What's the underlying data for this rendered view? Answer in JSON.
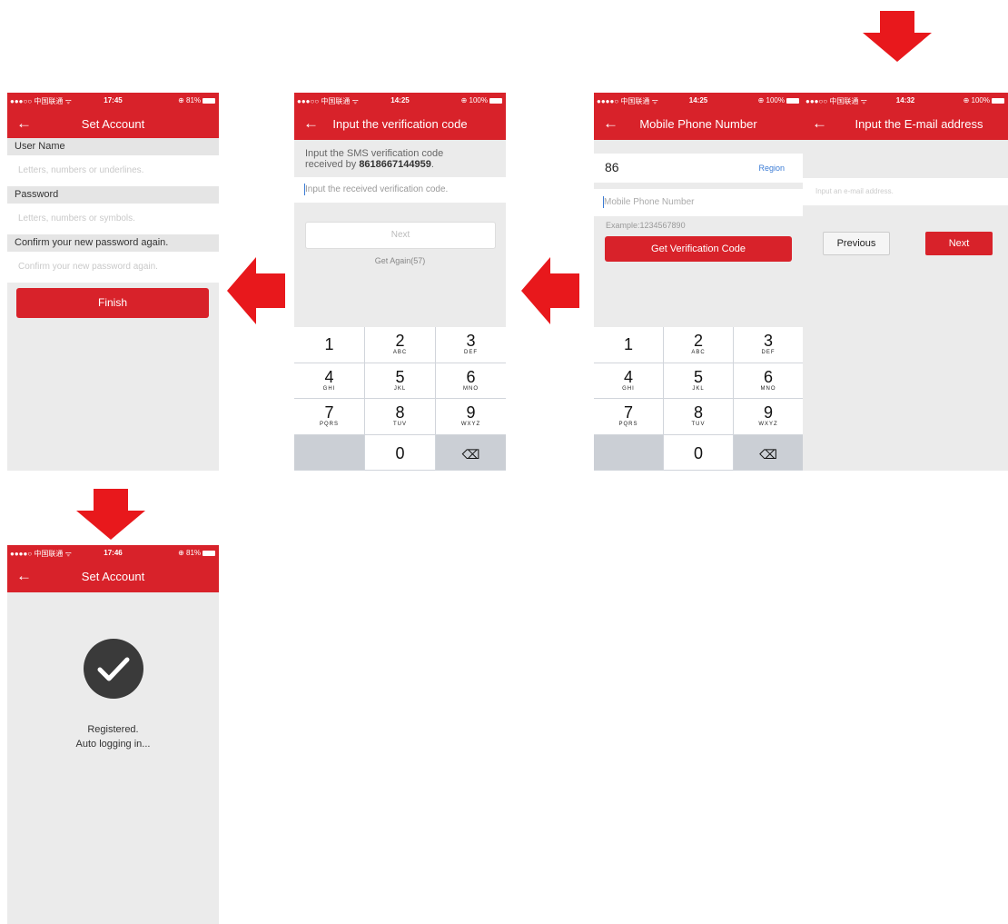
{
  "colors": {
    "brand_red": "#d8222a",
    "arrow_red": "#e8181c",
    "background": "#ebebeb",
    "link_blue": "#3a7bd5"
  },
  "screen_set_account": {
    "status": {
      "carrier": "●●●○○ 中国联通 ᯤ",
      "time": "17:45",
      "battery": "⊕ 81%"
    },
    "title": "Set Account",
    "username_label": "User Name",
    "username_placeholder": "Letters, numbers or underlines.",
    "password_label": "Password",
    "password_placeholder": "Letters, numbers or symbols.",
    "confirm_label": "Confirm your new password again.",
    "confirm_placeholder": "Confirm your new password again.",
    "finish_label": "Finish"
  },
  "screen_verification": {
    "status": {
      "carrier": "●●●○○ 中国联通 ᯤ",
      "time": "14:25",
      "battery": "⊕ 100%"
    },
    "title": "Input the verification code",
    "instruction_line1": "Input the SMS verification code",
    "instruction_prefix": "received by ",
    "phone_number": "8618667144959",
    "instruction_suffix": ".",
    "code_placeholder": "Input the received verification code.",
    "next_label": "Next",
    "get_again_label": "Get Again(57)"
  },
  "screen_mobile": {
    "status": {
      "carrier": "●●●●○ 中国联通 ᯤ",
      "time": "14:25",
      "battery": "⊕ 100%"
    },
    "title": "Mobile Phone Number",
    "country_code": "86",
    "region_label": "Region",
    "phone_placeholder": "Mobile Phone Number",
    "example_text": "Example:1234567890",
    "get_code_label": "Get Verification Code"
  },
  "screen_email": {
    "status": {
      "carrier": "●●●○○ 中国联通 ᯤ",
      "time": "14:32",
      "battery": "⊕ 100%"
    },
    "title": "Input the E-mail address",
    "email_placeholder": "Input an e-mail address.",
    "previous_label": "Previous",
    "next_label": "Next"
  },
  "screen_registered": {
    "status": {
      "carrier": "●●●●○ 中国联通 ᯤ",
      "time": "17:46",
      "battery": "⊕ 81%"
    },
    "title": "Set Account",
    "message_line1": "Registered.",
    "message_line2": "Auto logging in..."
  },
  "keypad": {
    "keys": [
      {
        "num": "1",
        "letters": ""
      },
      {
        "num": "2",
        "letters": "ABC"
      },
      {
        "num": "3",
        "letters": "DEF"
      },
      {
        "num": "4",
        "letters": "GHI"
      },
      {
        "num": "5",
        "letters": "JKL"
      },
      {
        "num": "6",
        "letters": "MNO"
      },
      {
        "num": "7",
        "letters": "PQRS"
      },
      {
        "num": "8",
        "letters": "TUV"
      },
      {
        "num": "9",
        "letters": "WXYZ"
      },
      {
        "num": "",
        "letters": ""
      },
      {
        "num": "0",
        "letters": ""
      },
      {
        "num": "⌫",
        "letters": ""
      }
    ]
  },
  "icons": {
    "back": "arrow-left-icon",
    "check": "checkmark-icon",
    "delete": "backspace-icon",
    "flow_arrow": "red-arrow-icon"
  }
}
